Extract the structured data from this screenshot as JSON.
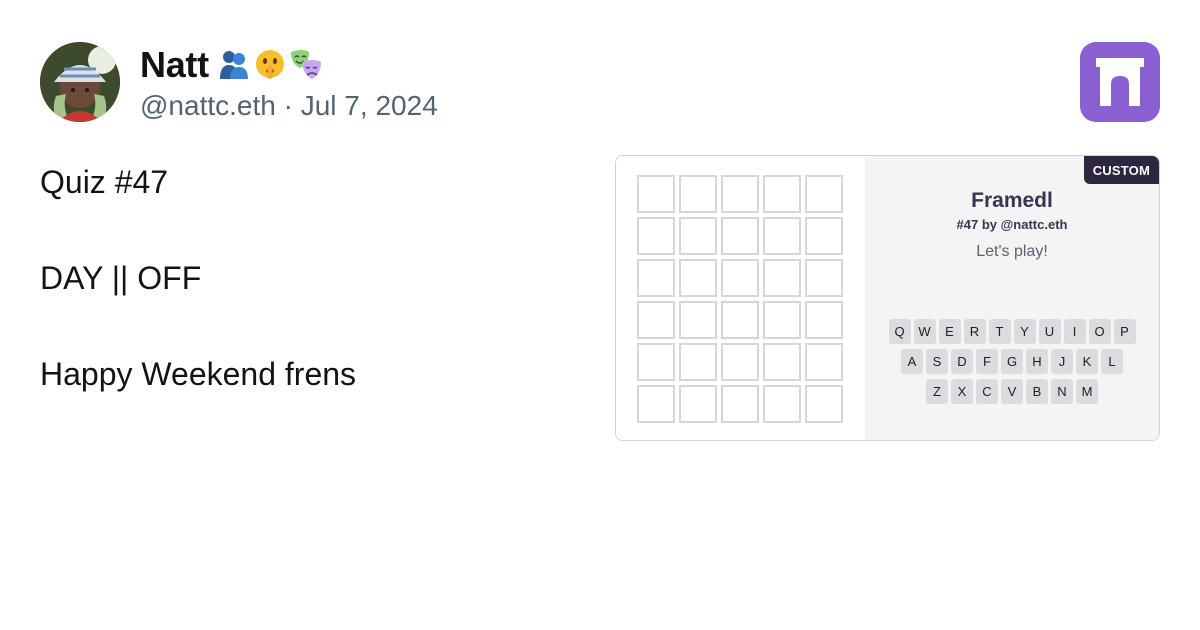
{
  "author": {
    "display_name": "Natt",
    "emoji_icons": [
      "people-hugging-icon",
      "shushing-face-icon",
      "performing-arts-icon"
    ],
    "handle": "@nattc.eth",
    "separator": "·",
    "date": "Jul 7, 2024"
  },
  "app_logo_icon": "framedl-arch-icon",
  "post": {
    "lines": [
      "Quiz #47",
      "DAY || OFF",
      "Happy Weekend frens"
    ]
  },
  "embed": {
    "badge": "CUSTOM",
    "title": "Framedl",
    "subtitle": "#47 by @nattc.eth",
    "prompt": "Let's play!",
    "grid": {
      "rows": 6,
      "cols": 5
    },
    "keyboard": [
      [
        "Q",
        "W",
        "E",
        "R",
        "T",
        "Y",
        "U",
        "I",
        "O",
        "P"
      ],
      [
        "A",
        "S",
        "D",
        "F",
        "G",
        "H",
        "J",
        "K",
        "L"
      ],
      [
        "Z",
        "X",
        "C",
        "V",
        "B",
        "N",
        "M"
      ]
    ]
  },
  "colors": {
    "logo_bg": "#8a5fd1",
    "badge_bg": "#2e2540",
    "handle": "#536471"
  }
}
